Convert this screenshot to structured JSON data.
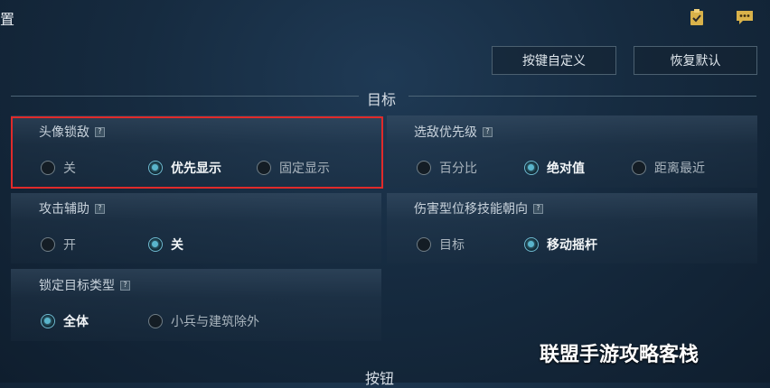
{
  "header": {
    "title_fragment": "置"
  },
  "toolbar": {
    "customize_keys_label": "按键自定义",
    "restore_defaults_label": "恢复默认"
  },
  "sections": {
    "target_title": "目标",
    "buttons_title": "按钮"
  },
  "help_glyph": "?",
  "panels": {
    "avatar_lock": {
      "title": "头像锁敌",
      "options": [
        "关",
        "优先显示",
        "固定显示"
      ],
      "selected_index": 1
    },
    "target_priority": {
      "title": "选敌优先级",
      "options": [
        "百分比",
        "绝对值",
        "距离最近"
      ],
      "selected_index": 1
    },
    "attack_assist": {
      "title": "攻击辅助",
      "options": [
        "开",
        "关"
      ],
      "selected_index": 1
    },
    "damage_skill_direction": {
      "title": "伤害型位移技能朝向",
      "options": [
        "目标",
        "移动摇杆"
      ],
      "selected_index": 1
    },
    "lock_target_type": {
      "title": "锁定目标类型",
      "options": [
        "全体",
        "小兵与建筑除外"
      ],
      "selected_index": 0
    }
  },
  "watermark": "联盟手游攻略客栈",
  "colors": {
    "accent_radio": "#5ab5cc",
    "highlight_border": "#e02a2a",
    "background": "#162b40"
  },
  "icons": [
    "clipboard-check-icon",
    "chat-bubble-icon",
    "help-icon"
  ]
}
